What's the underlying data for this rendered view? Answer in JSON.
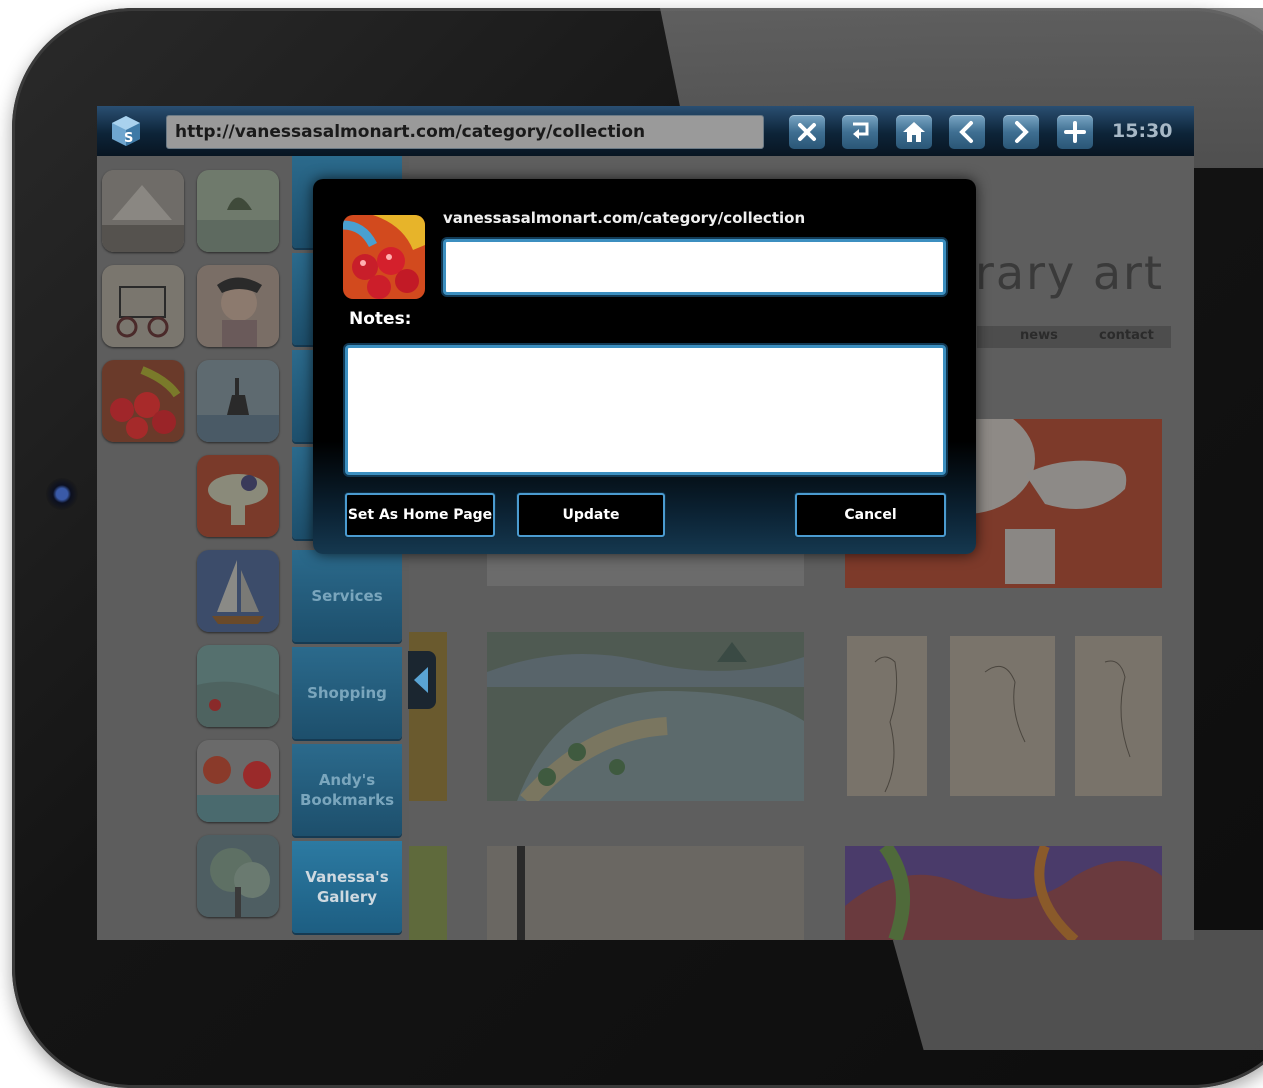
{
  "browser": {
    "url": "http://vanessasalmonart.com/category/collection",
    "clock": "15:30",
    "toolbar_icons": [
      "close-icon",
      "return-icon",
      "home-icon",
      "back-icon",
      "forward-icon",
      "add-icon"
    ]
  },
  "sidebar": {
    "nav_items": [
      {
        "label": "Services"
      },
      {
        "label": "Shopping"
      },
      {
        "label": "Andy's Bookmarks"
      },
      {
        "label": "Vanessa's Gallery"
      }
    ],
    "collapse_icon": "chevron-left-icon"
  },
  "webpage": {
    "title_fragment": "rary art",
    "menu": [
      "news",
      "contact"
    ]
  },
  "dialog": {
    "url": "vanessasalmonart.com/category/collection",
    "title_value": "",
    "notes_label": "Notes:",
    "notes_value": "",
    "buttons": {
      "set_home": "Set As Home Page",
      "update": "Update",
      "cancel": "Cancel"
    }
  },
  "colors": {
    "accent_blue": "#3c8fc0",
    "topbar": "#0d2438",
    "nav_tab": "#1d5e82"
  }
}
